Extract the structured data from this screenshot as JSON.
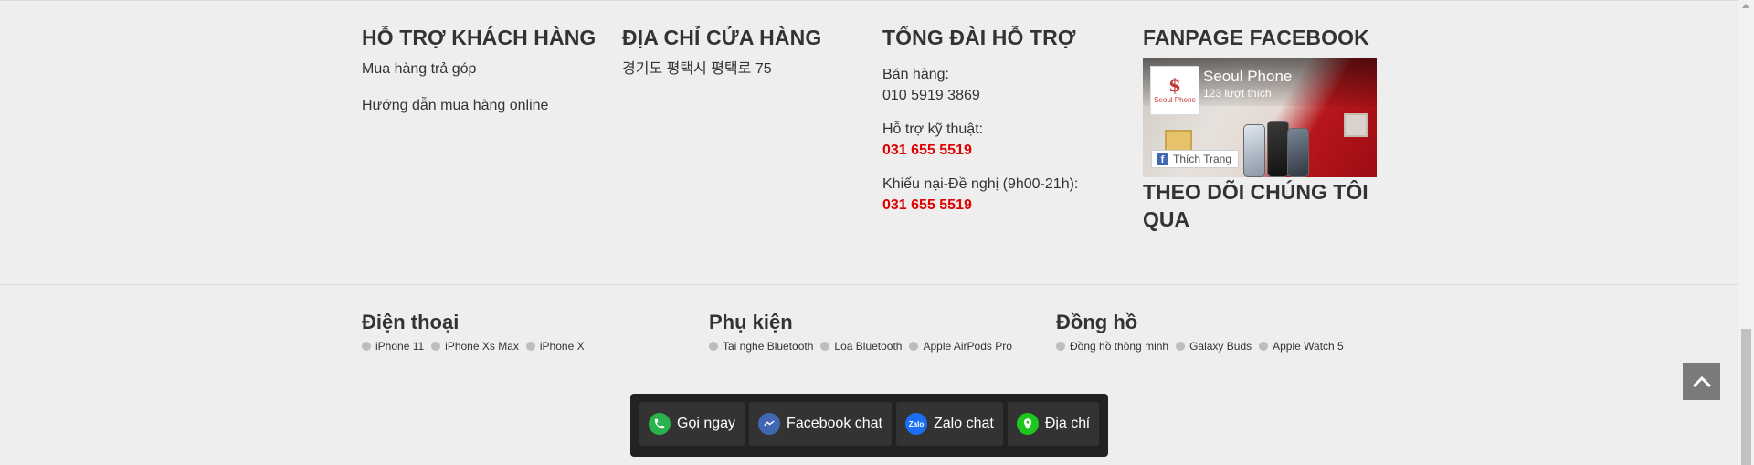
{
  "footer": {
    "support": {
      "title": "HỖ TRỢ KHÁCH HÀNG",
      "links": [
        "Mua hàng trả góp",
        "Hướng dẫn mua hàng online"
      ]
    },
    "store": {
      "title": "ĐỊA CHỈ CỬA HÀNG",
      "address": "경기도 평택시 평택로 75"
    },
    "hotline": {
      "title": "TỔNG ĐÀI HỖ TRỢ",
      "groups": [
        {
          "label": "Bán hàng:",
          "number": "010 5919 3869"
        },
        {
          "label": "Hỗ trợ kỹ thuật:",
          "number": "031 655 5519"
        },
        {
          "label": "Khiếu nại-Đề nghị (9h00-21h):",
          "number": "031 655 5519"
        }
      ],
      "highlight_color": "#e00000"
    },
    "facebook": {
      "title": "FANPAGE FACEBOOK",
      "page_name": "Seoul Phone",
      "likes": "123 lượt thích",
      "logo_text": "Seoul Phone",
      "like_button": "Thích Trang",
      "follow_title": "THEO DÕI CHÚNG TÔI QUA"
    }
  },
  "categories": [
    {
      "title": "Điện thoại",
      "items": [
        "iPhone 11",
        "iPhone Xs Max",
        "iPhone X"
      ]
    },
    {
      "title": "Phụ kiện",
      "items": [
        "Tai nghe Bluetooth",
        "Loa Bluetooth",
        "Apple AirPods Pro"
      ]
    },
    {
      "title": "Đồng hồ",
      "items": [
        "Đồng hồ thông minh",
        "Galaxy Buds",
        "Apple Watch 5"
      ]
    }
  ],
  "chat_bar": {
    "buttons": [
      {
        "label": "Gọi ngay",
        "icon": "phone-icon",
        "color": "#2bb24c"
      },
      {
        "label": "Facebook chat",
        "icon": "messenger-icon",
        "color": "#4267b2"
      },
      {
        "label": "Zalo chat",
        "icon": "zalo-icon",
        "color": "#1a6ff5"
      },
      {
        "label": "Địa chỉ",
        "icon": "map-pin-icon",
        "color": "#1ec71e"
      }
    ],
    "zalo_icon_text": "Zalo"
  },
  "back_to_top": {
    "icon": "chevron-up-icon"
  }
}
